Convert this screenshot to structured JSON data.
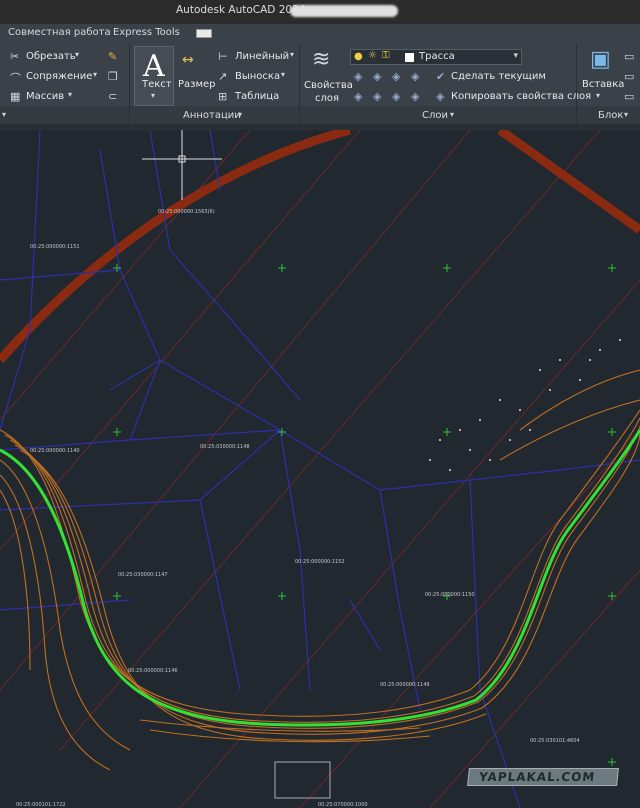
{
  "titlebar": {
    "title": "Autodesk AutoCAD 2024"
  },
  "tabs": [
    {
      "label": "Совместная работа"
    },
    {
      "label": "Express Tools"
    }
  ],
  "ribbon": {
    "modify": {
      "trim": "Обрезать",
      "fillet": "Сопряжение",
      "array": "Массив"
    },
    "annotation": {
      "text": "Текст",
      "dimension": "Размер",
      "linear": "Линейный",
      "leader": "Выноска",
      "table": "Таблица",
      "panel_label": "Аннотации"
    },
    "layers": {
      "properties_line1": "Свойства",
      "properties_line2": "слоя",
      "current_layer": "Трасса",
      "make_current": "Сделать текущим",
      "match_layer": "Копировать свойства слоя",
      "panel_label": "Слои"
    },
    "block": {
      "insert": "Вставка",
      "panel_label": "Блок"
    }
  },
  "colors": {
    "ribbon": "#3b4148",
    "canvas": "#212830",
    "road": "#c07020",
    "highlight": "#33e033",
    "boundary": "#2f2fa8",
    "border": "#8a2a10"
  },
  "canvas_labels": {
    "l1": "00:25:000000:1563(6)",
    "l2": "00:25:000000:1151",
    "l3": "00:25:000000:1140",
    "l4": "00:25:030000:1148",
    "l5": "00:25:000000:1152",
    "l6": "00:25:030000:1147",
    "l7": "00:25:000000:1146",
    "l8": "00:25:000000:1150",
    "l9": "00:25:000000:1149",
    "l10": "00:25:000101:1722",
    "l11": "00:25:030101:4604",
    "l12": "00:25:070000:1000"
  },
  "watermark": "YAPLAKAL.COM"
}
